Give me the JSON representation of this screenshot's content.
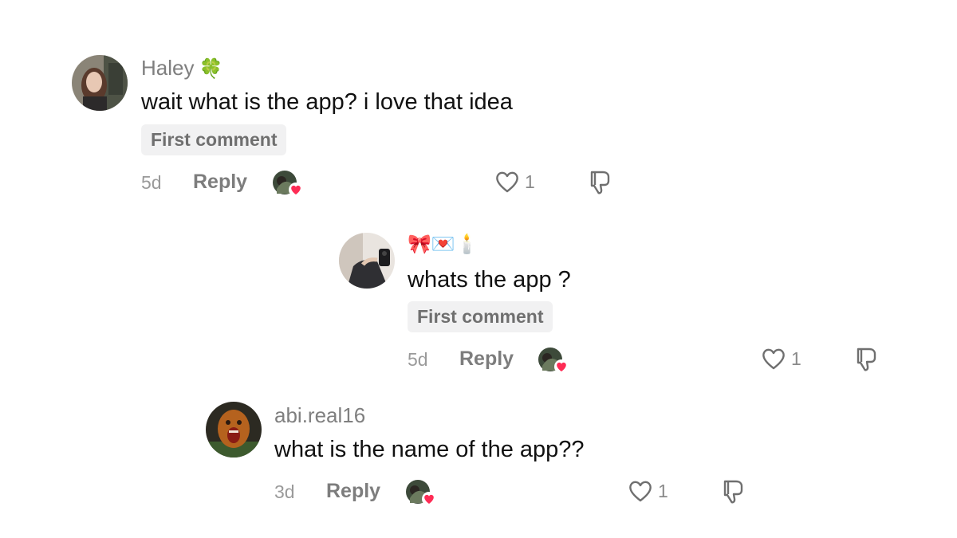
{
  "comments": [
    {
      "username": "Haley",
      "username_emoji": "🍀",
      "text": "wait what is the app? i love that idea",
      "badge": "First comment",
      "time": "5d",
      "reply_label": "Reply",
      "like_count": "1"
    },
    {
      "username": "",
      "username_emoji": "🎀💌🕯️",
      "text": "whats the app ?",
      "badge": "First comment",
      "time": "5d",
      "reply_label": "Reply",
      "like_count": "1"
    },
    {
      "username": "abi.real16",
      "username_emoji": "",
      "text": "what is the name of the app??",
      "time": "3d",
      "reply_label": "Reply",
      "like_count": "1"
    }
  ],
  "colors": {
    "heart_badge": "#fe2c55",
    "text": "#111111",
    "muted": "#7f7f7f",
    "badge_bg": "#f1f1f2"
  }
}
